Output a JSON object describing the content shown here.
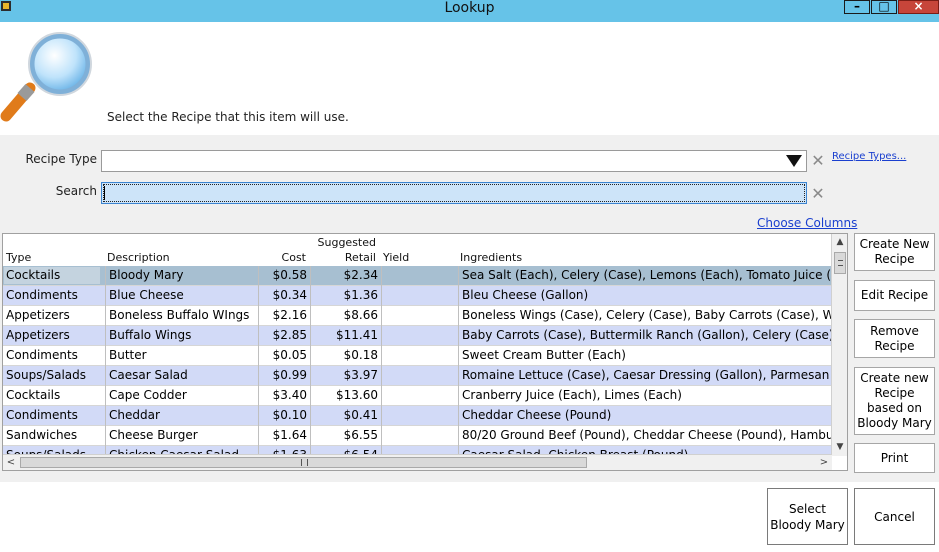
{
  "window": {
    "title": "Lookup",
    "minimize": "–",
    "maximize": "□",
    "close": "×"
  },
  "header": {
    "instruction": "Select the Recipe that this item will use."
  },
  "form": {
    "recipe_type_label": "Recipe Type",
    "recipe_type_value": "",
    "recipe_types_link": "Recipe Types...",
    "search_label": "Search",
    "search_value": "",
    "clear_glyph": "✕"
  },
  "grid": {
    "choose_columns": "Choose Columns",
    "columns": {
      "type": "Type",
      "description": "Description",
      "cost": "Cost",
      "suggested": "Suggested",
      "retail": "Retail",
      "yield": "Yield",
      "ingredients": "Ingredients"
    },
    "rows": [
      {
        "type": "Cocktails",
        "description": "Bloody Mary",
        "cost": "$0.58",
        "retail": "$2.34",
        "yield": "",
        "ingredients": "Sea Salt (Each), Celery (Case), Lemons (Each), Tomato Juice (Bottle)"
      },
      {
        "type": "Condiments",
        "description": "Blue Cheese",
        "cost": "$0.34",
        "retail": "$1.36",
        "yield": "",
        "ingredients": "Bleu Cheese (Gallon)"
      },
      {
        "type": "Appetizers",
        "description": "Boneless Buffalo WIngs",
        "cost": "$2.16",
        "retail": "$8.66",
        "yield": "",
        "ingredients": "Boneless Wings (Case), Celery (Case), Baby Carrots (Case), Wing Sau"
      },
      {
        "type": "Appetizers",
        "description": "Buffalo Wings",
        "cost": "$2.85",
        "retail": "$11.41",
        "yield": "",
        "ingredients": "Baby Carrots (Case), Buttermilk Ranch (Gallon), Celery (Case), Chick"
      },
      {
        "type": "Condiments",
        "description": "Butter",
        "cost": "$0.05",
        "retail": "$0.18",
        "yield": "",
        "ingredients": "Sweet Cream Butter (Each)"
      },
      {
        "type": "Soups/Salads",
        "description": "Caesar Salad",
        "cost": "$0.99",
        "retail": "$3.97",
        "yield": "",
        "ingredients": "Romaine Lettuce (Case), Caesar Dressing (Gallon), Parmesan Chees"
      },
      {
        "type": "Cocktails",
        "description": "Cape Codder",
        "cost": "$3.40",
        "retail": "$13.60",
        "yield": "",
        "ingredients": "Cranberry Juice (Each), Limes (Each)"
      },
      {
        "type": "Condiments",
        "description": "Cheddar",
        "cost": "$0.10",
        "retail": "$0.41",
        "yield": "",
        "ingredients": "Cheddar Cheese (Pound)"
      },
      {
        "type": "Sandwiches",
        "description": "Cheese Burger",
        "cost": "$1.64",
        "retail": "$6.55",
        "yield": "",
        "ingredients": "80/20 Ground Beef (Pound), Cheddar Cheese (Pound), Hamburger E"
      },
      {
        "type": "Soups/Salads",
        "description": "Chicken Caesar Salad",
        "cost": "$1.63",
        "retail": "$6.54",
        "yield": "",
        "ingredients": "Caesar Salad, Chicken Breast (Pound)"
      }
    ]
  },
  "side_buttons": {
    "create_new": "Create New Recipe",
    "edit": "Edit Recipe",
    "remove": "Remove Recipe",
    "create_based": "Create new Recipe based on Bloody Mary",
    "print": "Print"
  },
  "bottom_buttons": {
    "select": "Select Bloody Mary",
    "cancel": "Cancel"
  },
  "colors": {
    "titlebar": "#66c3e8",
    "row_alt": "#d2daf7",
    "row_selected": "#a7bfd1",
    "link": "#1a3fcf"
  },
  "icons": {
    "app": "app-icon",
    "header": "magnifier-icon",
    "dropdown": "triangle-down-icon",
    "clear": "close-x-icon"
  }
}
